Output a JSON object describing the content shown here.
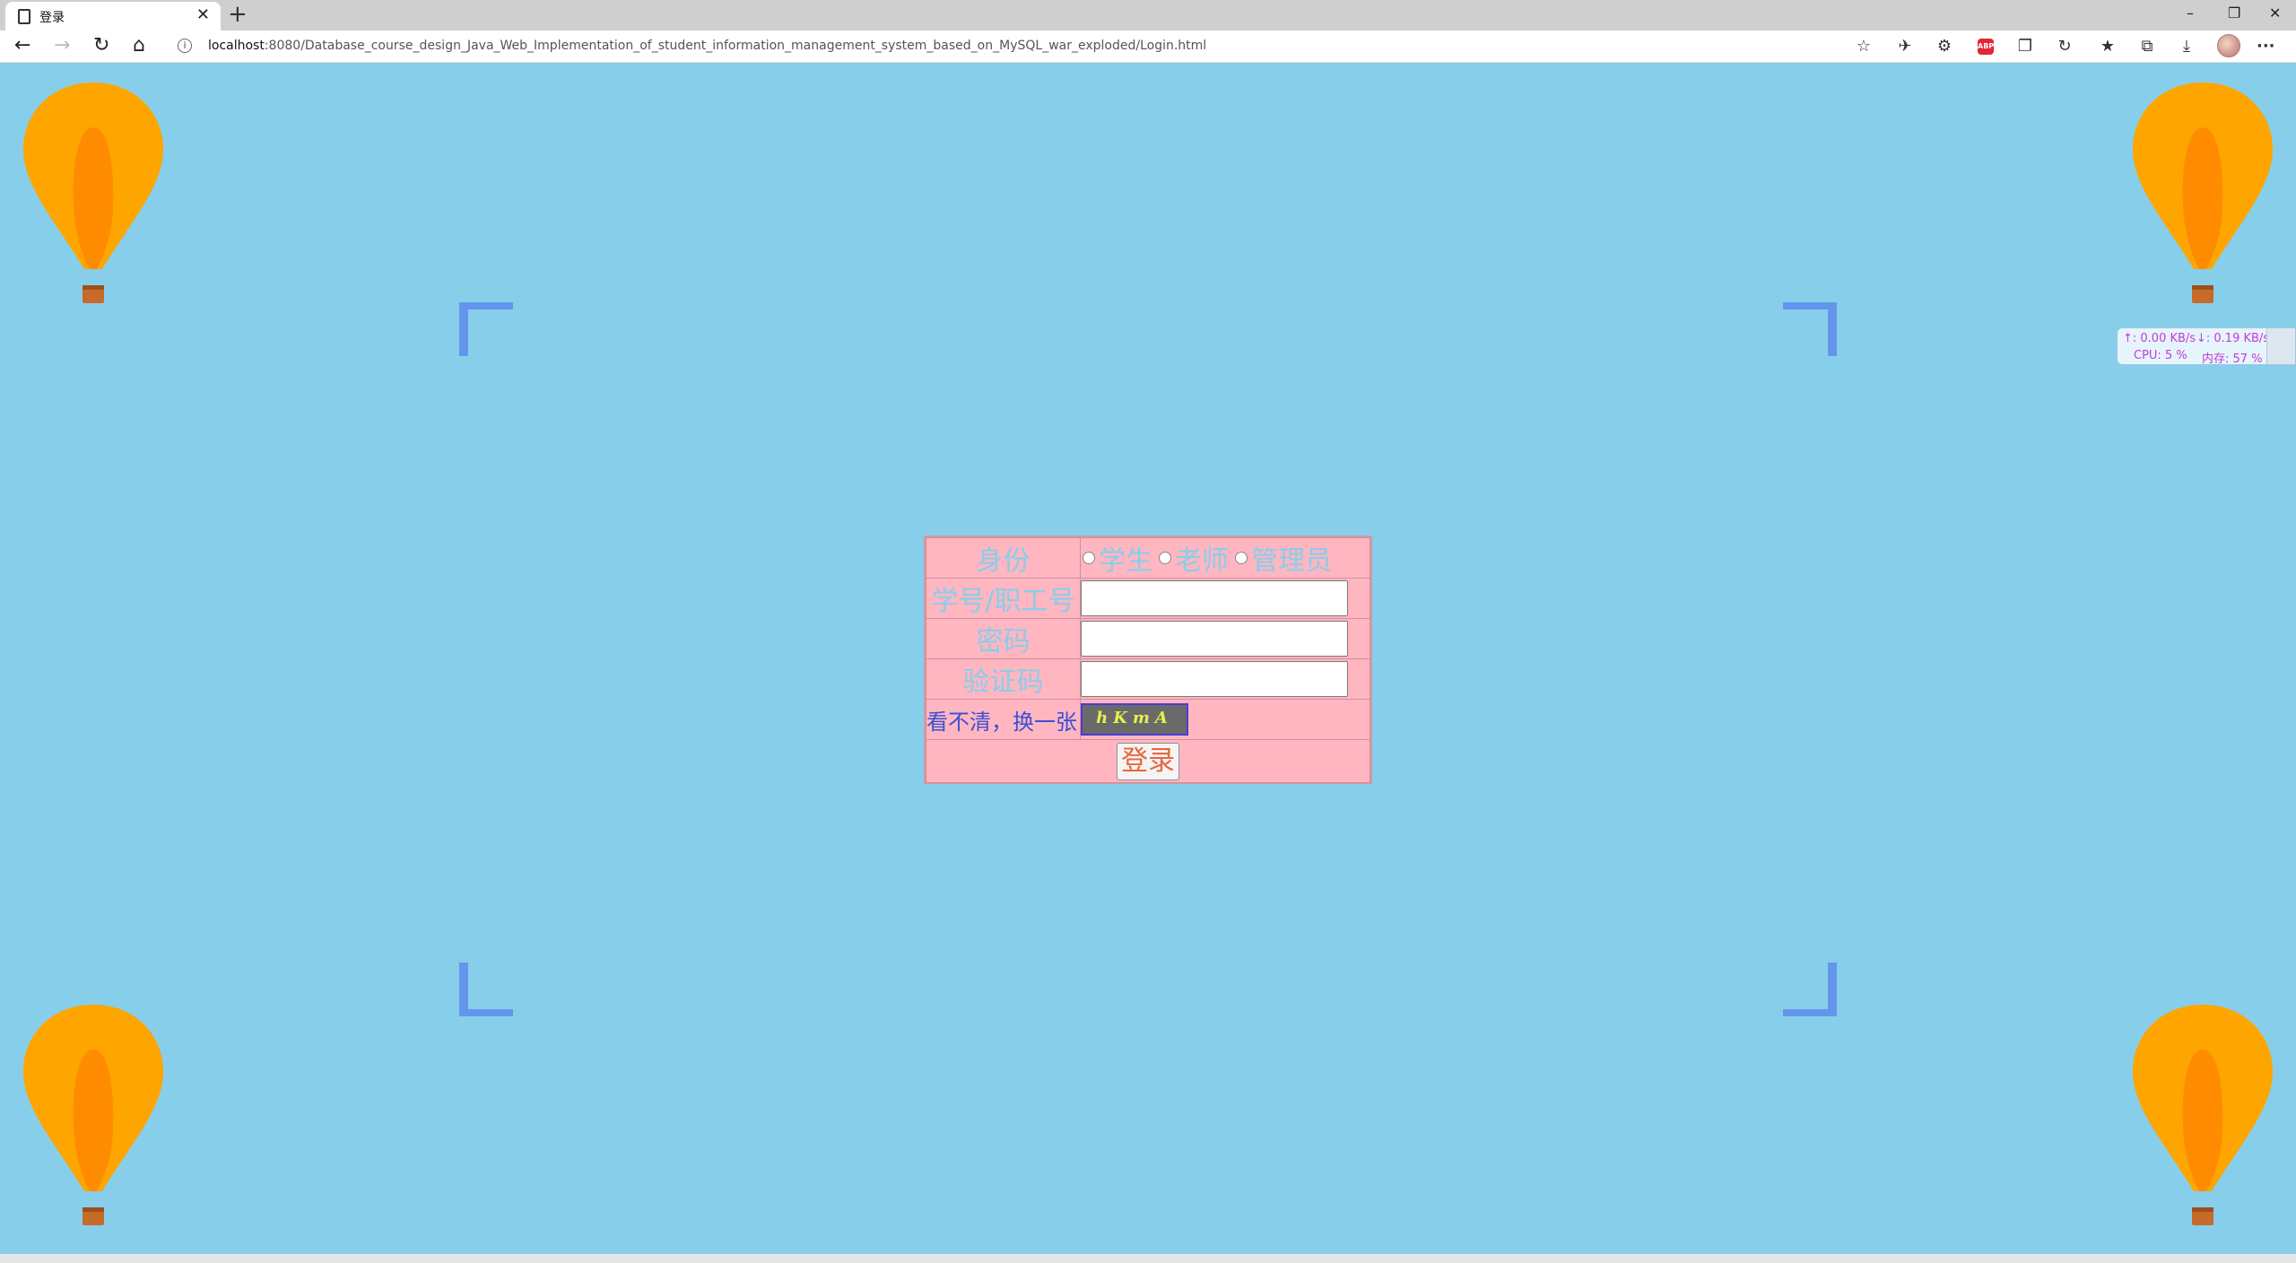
{
  "browser": {
    "tab_title": "登录",
    "tab_close": "✕",
    "new_tab": "+",
    "window_controls": {
      "minimize": "–",
      "restore": "❐",
      "close": "✕"
    },
    "nav": {
      "back": "←",
      "forward": "→",
      "reload": "↻",
      "home": "⌂"
    },
    "url_host": "localhost",
    "url_rest": ":8080/Database_course_design_Java_Web_Implementation_of_student_information_management_system_based_on_MySQL_war_exploded/Login.html",
    "toolbar_icons": [
      "favorite-add-icon",
      "extension-plane-icon",
      "extension-settings-icon",
      "adblock-icon",
      "collections-icon",
      "sync-icon",
      "favorites-icon",
      "tab-collections-icon",
      "download-icon",
      "profile-avatar",
      "more-menu-icon"
    ],
    "adblock_label": "ABP",
    "more_label": "···"
  },
  "login": {
    "identity_label": "身份",
    "roles": [
      "学生",
      "老师",
      "管理员"
    ],
    "id_label": "学号/职工号",
    "password_label": "密码",
    "captcha_label": "验证码",
    "refresh_link": "看不清，换一张",
    "captcha_text": "hKmA",
    "submit_label": "登录",
    "id_value": "",
    "password_value": "",
    "captcha_value": ""
  },
  "net_monitor": {
    "upload": "↑: 0.00 KB/s",
    "download": "↓: 0.19 KB/s",
    "cpu": "CPU: 5 %",
    "memory": "内存: 57 %"
  },
  "colors": {
    "page_background": "#87ceeb",
    "table_background": "#ffb6c1",
    "label_color": "#87ceeb",
    "corner_color": "#6495ed",
    "balloon_outer": "#ffa500",
    "balloon_inner": "#ff8c00",
    "submit_text": "#e8663e"
  }
}
